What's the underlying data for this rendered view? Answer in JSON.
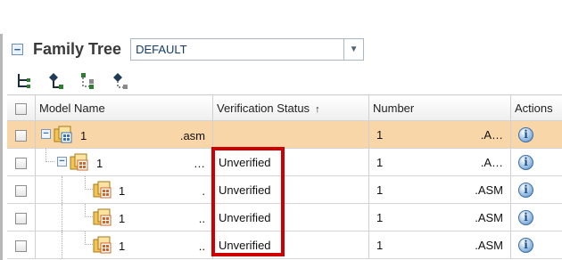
{
  "header": {
    "title": "Family Tree",
    "selector_value": "DEFAULT"
  },
  "toolbar": {
    "icons": [
      "insert-column-icon",
      "add-tree-icon",
      "tree-structure-icon",
      "move-node-icon"
    ]
  },
  "table": {
    "columns": {
      "model_name": "Model Name",
      "verification_status": "Verification Status",
      "number": "Number",
      "actions": "Actions"
    },
    "sort_indicator": "↑",
    "rows": [
      {
        "name": "1",
        "name_suffix": ".asm",
        "status": "",
        "number": "1",
        "number_suffix": ".A…",
        "highlighted": true
      },
      {
        "name": "1",
        "name_suffix": "…",
        "status": "Unverified",
        "number": "1",
        "number_suffix": ".A…",
        "highlighted": false
      },
      {
        "name": "1",
        "name_suffix": ".",
        "status": "Unverified",
        "number": "1",
        "number_suffix": ".ASM",
        "highlighted": false
      },
      {
        "name": "1",
        "name_suffix": "..",
        "status": "Unverified",
        "number": "1",
        "number_suffix": ".ASM",
        "highlighted": false
      },
      {
        "name": "1",
        "name_suffix": "..",
        "status": "Unverified",
        "number": "1",
        "number_suffix": ".ASM",
        "highlighted": false
      }
    ]
  },
  "colors": {
    "highlight_row": "#f8d6a7",
    "annotation_red": "#cc0000",
    "title_text": "#3a3a3a"
  }
}
